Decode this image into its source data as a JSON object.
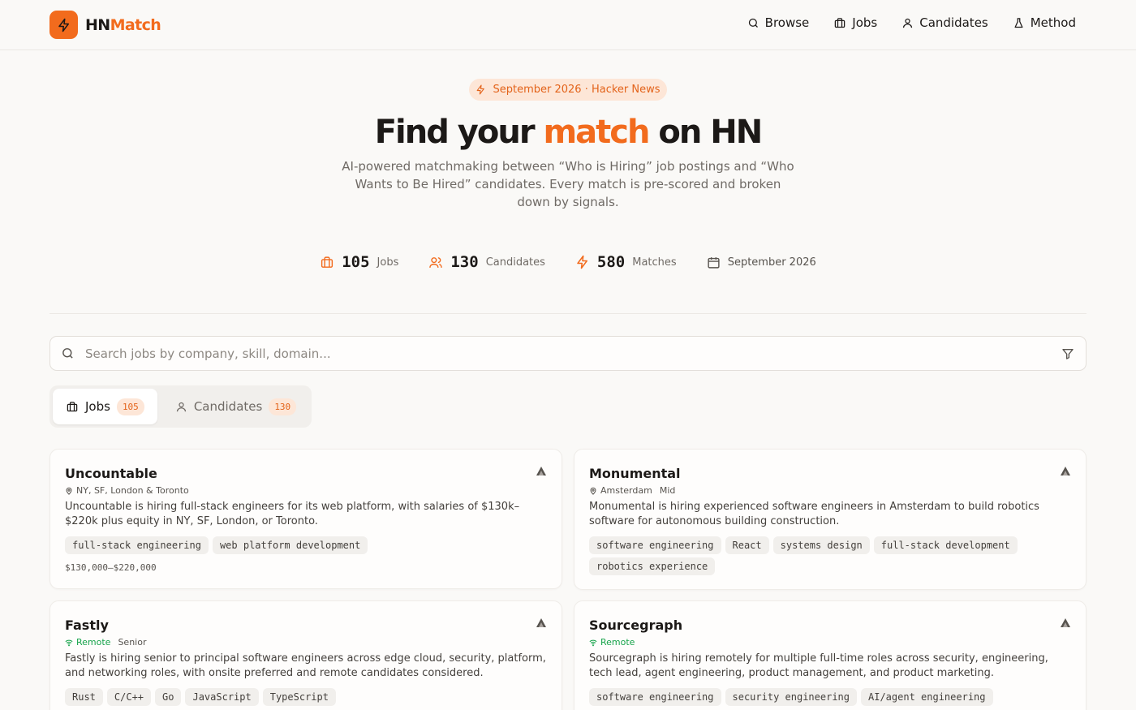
{
  "brand": {
    "name_part1": "HN",
    "name_part2": "Match",
    "logo_icon": "lightning-icon",
    "accent_color": "#f26b1d"
  },
  "nav": {
    "items": [
      {
        "label": "Browse",
        "icon": "search-icon"
      },
      {
        "label": "Jobs",
        "icon": "briefcase-icon"
      },
      {
        "label": "Candidates",
        "icon": "user-icon"
      },
      {
        "label": "Method",
        "icon": "flask-icon"
      }
    ]
  },
  "hero": {
    "badge": "September 2026 · Hacker News",
    "title_before": "Find your",
    "title_accent": "match",
    "title_after": "on HN",
    "subtitle": "AI-powered matchmaking between “Who is Hiring” job postings and “Who Wants to Be Hired” candidates. Every match is pre-scored and broken down by signals."
  },
  "stats": [
    {
      "value": "105",
      "label": "Jobs",
      "icon": "briefcase-icon"
    },
    {
      "value": "130",
      "label": "Candidates",
      "icon": "users-icon"
    },
    {
      "value": "580",
      "label": "Matches",
      "icon": "lightning-icon"
    },
    {
      "value": "",
      "label": "September 2026",
      "icon": "calendar-icon"
    }
  ],
  "search": {
    "placeholder": "Search jobs by company, skill, domain...",
    "value": ""
  },
  "tabs": [
    {
      "label": "Jobs",
      "count": "105",
      "active": true
    },
    {
      "label": "Candidates",
      "count": "130",
      "active": false
    }
  ],
  "cards": [
    {
      "company": "Uncountable",
      "location": "NY, SF, London & Toronto",
      "seniority": "",
      "description": "Uncountable is hiring full-stack engineers for its web platform, with salaries of $130k–$220k plus equity in NY, SF, London, or Toronto.",
      "tags": [
        "full-stack engineering",
        "web platform development"
      ],
      "salary": "$130,000–$220,000"
    },
    {
      "company": "Monumental",
      "location": "Amsterdam",
      "seniority": "Mid",
      "description": "Monumental is hiring experienced software engineers in Amsterdam to build robotics software for autonomous building construction.",
      "tags": [
        "software engineering",
        "React",
        "systems design",
        "full-stack development",
        "robotics experience"
      ],
      "salary": ""
    },
    {
      "company": "Fastly",
      "location": "Remote",
      "seniority": "Senior",
      "description": "Fastly is hiring senior to principal software engineers across edge cloud, security, platform, and networking roles, with onsite preferred and remote candidates considered.",
      "tags": [
        "Rust",
        "C/C++",
        "Go",
        "JavaScript",
        "TypeScript"
      ],
      "salary": ""
    },
    {
      "company": "Sourcegraph",
      "location": "Remote",
      "seniority": "",
      "description": "Sourcegraph is hiring remotely for multiple full-time roles across security, engineering, tech lead, agent engineering, product management, and product marketing.",
      "tags": [
        "software engineering",
        "security engineering",
        "AI/agent engineering"
      ],
      "salary": ""
    }
  ]
}
